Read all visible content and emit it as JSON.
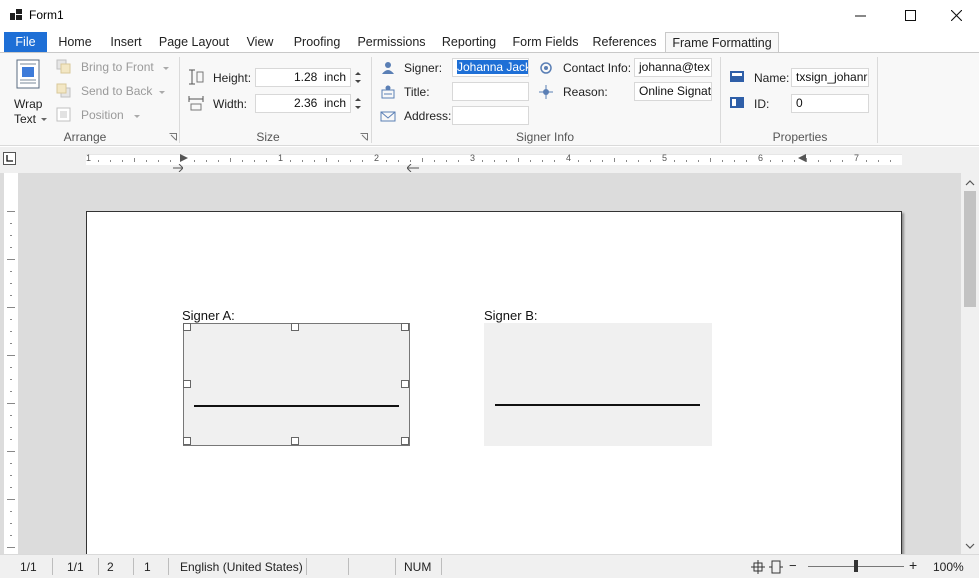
{
  "window": {
    "title": "Form1",
    "minimize_label": "",
    "controls": [
      "minimize-icon",
      "maximize-icon",
      "close-icon"
    ]
  },
  "tabs": [
    {
      "label": "File"
    },
    {
      "label": "Home"
    },
    {
      "label": "Insert"
    },
    {
      "label": "Page Layout"
    },
    {
      "label": "View"
    },
    {
      "label": "Proofing"
    },
    {
      "label": "Permissions"
    },
    {
      "label": "Reporting"
    },
    {
      "label": "Form Fields"
    },
    {
      "label": "References"
    },
    {
      "label": "Frame Formatting"
    }
  ],
  "ribbon": {
    "arrange": {
      "wrap_text_line1": "Wrap",
      "wrap_text_line2": "Text",
      "bring_to_front": "Bring to Front",
      "send_to_back": "Send to Back",
      "position": "Position",
      "group_label": "Arrange"
    },
    "size": {
      "height_label": "Height:",
      "height_value": "1.28",
      "width_label": "Width:",
      "width_value": "2.36",
      "unit": "inch",
      "group_label": "Size"
    },
    "signer_info": {
      "signer_label": "Signer:",
      "signer_value": "Johanna Jack",
      "title_label": "Title:",
      "title_value": "",
      "address_label": "Address:",
      "address_value": "",
      "contact_label": "Contact Info:",
      "contact_value": "johanna@tex",
      "reason_label": "Reason:",
      "reason_value": "Online Signat",
      "group_label": "Signer Info"
    },
    "properties": {
      "name_label": "Name:",
      "name_value": "txsign_johanr",
      "id_label": "ID:",
      "id_value": "0",
      "group_label": "Properties"
    }
  },
  "ruler": {
    "numbers": [
      "1",
      "1",
      "2",
      "3",
      "4",
      "5",
      "6",
      "7"
    ]
  },
  "document": {
    "signer_a_label": "Signer A:",
    "signer_b_label": "Signer B:"
  },
  "status": {
    "page": "1/1",
    "section": "1/1",
    "line": "2",
    "column": "1",
    "language": "English (United States)",
    "num": "NUM",
    "zoom": "100%",
    "zoom_level": 0.5
  },
  "colors": {
    "accent": "#1e6fd6",
    "selection": "#1e6fd6"
  }
}
